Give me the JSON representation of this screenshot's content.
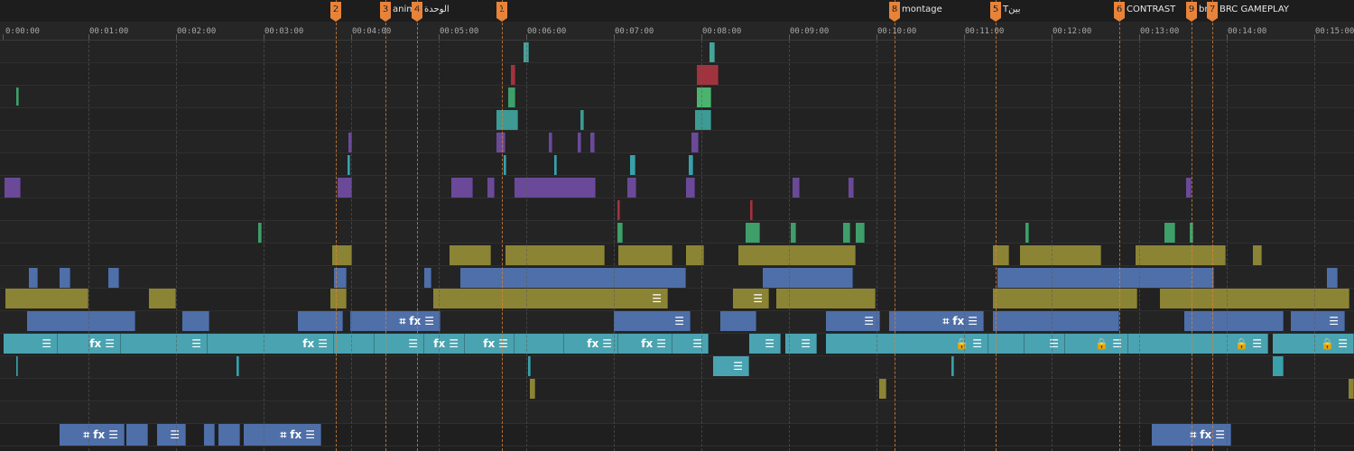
{
  "timeline": {
    "time_ruler": [
      "0:00:00",
      "00:01:00",
      "00:02:00",
      "00:03:00",
      "00:04:00",
      "00:05:00",
      "00:06:00",
      "00:07:00",
      "00:08:00",
      "00:09:00",
      "00:10:00",
      "00:11:00",
      "00:12:00",
      "00:13:00",
      "00:14:00",
      "00:15:00"
    ],
    "markers": [
      {
        "number": "2",
        "label": ""
      },
      {
        "number": "3",
        "label": "anima"
      },
      {
        "number": "4",
        "label": "الوحدة"
      },
      {
        "number": "1",
        "label": ""
      },
      {
        "number": "8",
        "label": "montage"
      },
      {
        "number": "5",
        "label": "Tبين"
      },
      {
        "number": "6",
        "label": "CONTRAST"
      },
      {
        "number": "9",
        "label": "bri"
      },
      {
        "number": "7",
        "label": "BRC GAMEPLAY"
      }
    ],
    "clip_icons": {
      "menu": "☰",
      "fx": "fx",
      "crop": "⌗",
      "lock": "🔒"
    },
    "colors": {
      "background": "#1f1f1f",
      "marker": "#e8833a",
      "teal": "#4aa3b0",
      "blue": "#4f6fa8",
      "olive": "#8c8435",
      "purple": "#6a4a98",
      "green": "#3f9e6a",
      "red": "#a0343e"
    }
  }
}
